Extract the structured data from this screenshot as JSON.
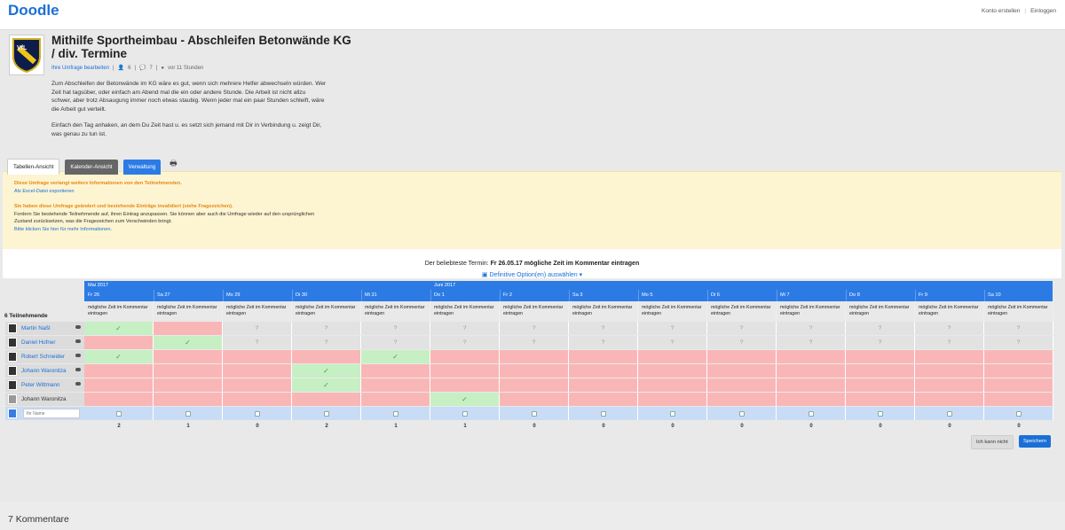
{
  "topbar": {
    "logo": "Doodle",
    "create_account": "Konto erstellen",
    "sep": "|",
    "login": "Einloggen"
  },
  "poll": {
    "title": "Mithilfe Sportheimbau - Abschleifen Betonwände KG / div. Termine",
    "edit_link": "Ihre Umfrage bearbeiten",
    "participants_count": "6",
    "comments_count": "7",
    "time_ago": "vor 11 Stunden",
    "description_1": "Zum Abschleifen der Betonwände im KG wäre es gut, wenn sich mehrere Helfer abwechseln würden. Wer Zeit hat tagsüber, oder einfach am Abend mal die ein oder andere Stunde. Die Arbeit ist nicht allzu schwer, aber trotz Absaugung immer noch etwas staubig. Wenn jeder mal ein paar Stunden schleift, wäre die Arbeit gut verteilt.",
    "description_2": "Einfach den Tag anhaken, an dem Du Zeit hast u. es setzt sich jemand mit Dir in Verbindung u. zeigt Dir, was genau zu tun ist."
  },
  "tabs": {
    "table": "Tabellen-Ansicht",
    "calendar": "Kalender-Ansicht",
    "admin": "Verwaltung"
  },
  "notice": {
    "warn1": "Diese Umfrage verlangt weitere Informationen von den Teilnehmenden.",
    "export": "Als Excel-Datei exportieren",
    "warn2": "Sie haben diese Umfrage geändert und bestehende Einträge invalidiert (siehe Fragezeichen).",
    "body2": "Fordern Sie bestehende Teilnehmende auf, ihren Eintrag anzupassen. Sie können aber auch die Umfrage wieder auf den ursprünglichen Zustand zurücksetzen, was die Fragezeichen zum Verschwinden bringt.",
    "more": "Bitte klicken Sie hier für mehr Informationen."
  },
  "popular": {
    "prefix": "Der beliebteste Termin:",
    "value": "Fr 26.05.17 mögliche Zeit im Kommentar eintragen",
    "definitive": "Definitive Option(en) auswählen"
  },
  "grid": {
    "participants_label": "6 Teilnehmende",
    "months": [
      "Mai 2017",
      "Juni 2017"
    ],
    "days": [
      "Fr 26",
      "Sa 27",
      "Mo 29",
      "Di 30",
      "Mi 31",
      "Do 1",
      "Fr 2",
      "Sa 3",
      "Mo 5",
      "Di 6",
      "Mi 7",
      "Do 8",
      "Fr 9",
      "Sa 10"
    ],
    "option_text": "mögliche Zeit im Kommentar eintragen",
    "participants": [
      {
        "name": "Martin Naßl",
        "row": "YNQQQQQQQQQQQQ"
      },
      {
        "name": "Daniel Hofner",
        "row": "NYQQQQQQQQQQQQ"
      },
      {
        "name": "Robert Schneider",
        "row": "YNNNYNNNNNNNNN"
      },
      {
        "name": "Johann Waronitza",
        "row": "NNNYNNNNNNNNNN"
      },
      {
        "name": "Peter Wittmann",
        "row": "NNNYNNNNNNNNNN"
      },
      {
        "name": "Johann Waronitza",
        "row": "NNNNNYNNNNNNNN"
      }
    ],
    "name_placeholder": "Ihr Name",
    "totals": [
      "2",
      "1",
      "0",
      "2",
      "1",
      "1",
      "0",
      "0",
      "0",
      "0",
      "0",
      "0",
      "0",
      "0"
    ],
    "cant_button": "Ich kann nicht",
    "save_button": "Speichern"
  },
  "comments": {
    "title": "7 Kommentare"
  }
}
